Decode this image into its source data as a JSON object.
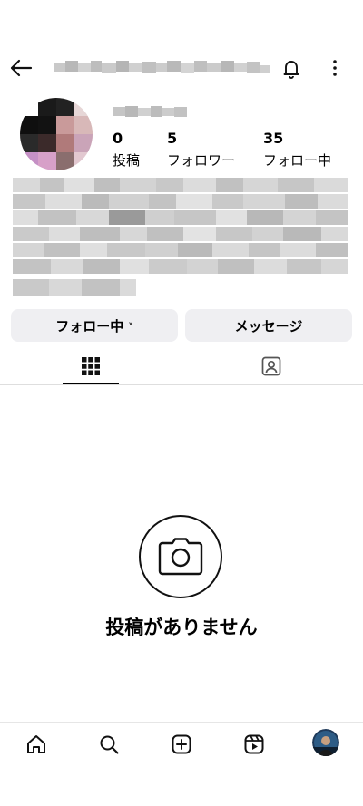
{
  "header": {
    "back_icon": "arrow-left-icon",
    "handle_blurred": "",
    "bell_icon": "bell-icon",
    "more_icon": "more-vertical-icon"
  },
  "profile": {
    "display_name_blurred": "",
    "stats": [
      {
        "number": "0",
        "label": "投稿"
      },
      {
        "number": "5",
        "label": "フォロワー"
      },
      {
        "number": "35",
        "label": "フォロー中"
      }
    ]
  },
  "actions": {
    "following_label": "フォロー中",
    "following_chevron": "˅",
    "message_label": "メッセージ"
  },
  "tabs": {
    "grid_icon": "grid-icon",
    "tagged_icon": "tagged-person-icon"
  },
  "empty_state": {
    "icon": "camera-icon",
    "label": "投稿がありません"
  },
  "bottom_nav": {
    "items": [
      "home-icon",
      "search-icon",
      "create-icon",
      "reels-icon",
      "profile-avatar"
    ]
  }
}
